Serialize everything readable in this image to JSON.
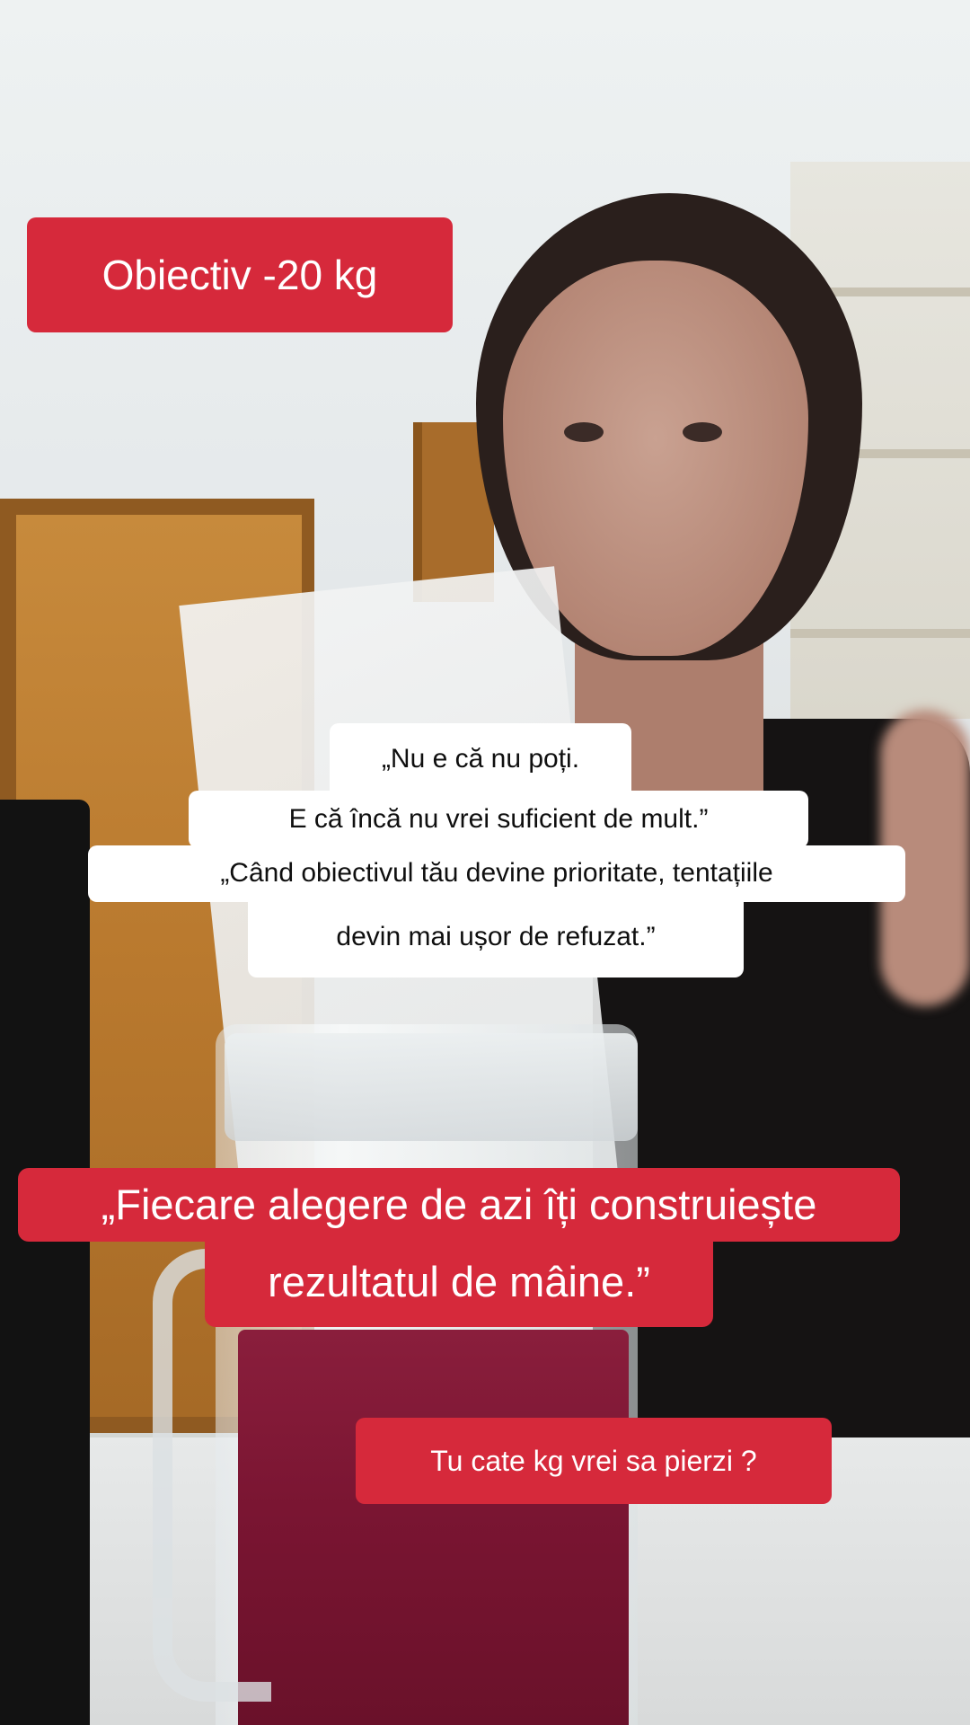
{
  "overlay": {
    "goal_badge": "Obiectiv -20 kg",
    "quote_white": [
      "„Nu e că nu poți.",
      "E că încă nu vrei suficient de mult.”",
      "„Când obiectivul tău devine prioritate, tentațiile",
      "devin mai ușor de refuzat.”"
    ],
    "quote_red": [
      "„Fiecare alegere de azi îți construiește",
      "rezultatul de mâine.”"
    ],
    "question": "Tu cate kg vrei sa pierzi ?"
  },
  "colors": {
    "accent_red": "#d6293b",
    "caption_white": "#ffffff",
    "caption_text_dark": "#0f0f0f"
  }
}
